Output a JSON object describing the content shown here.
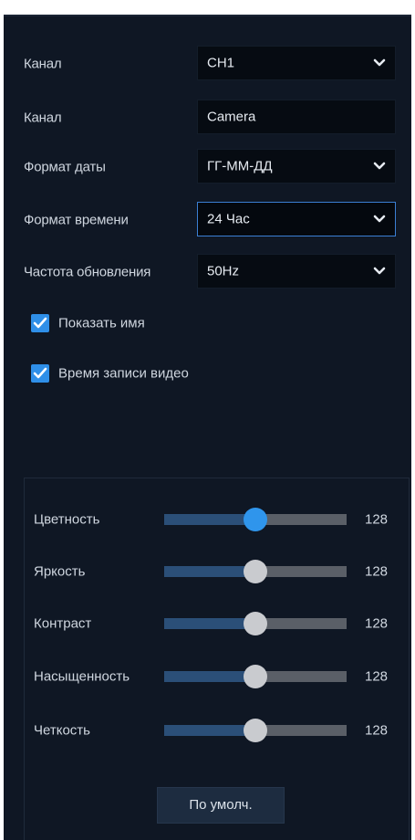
{
  "settings": {
    "channel_select": {
      "label": "Канал",
      "value": "CH1",
      "icon": "chevron-down-icon"
    },
    "channel_name": {
      "label": "Канал",
      "value": "Camera"
    },
    "date_format": {
      "label": "Формат даты",
      "value": "ГГ-ММ-ДД",
      "icon": "chevron-down-icon"
    },
    "time_format": {
      "label": "Формат времени",
      "value": "24 Час",
      "icon": "chevron-down-icon"
    },
    "refresh_rate": {
      "label": "Частота обновления",
      "value": "50Hz",
      "icon": "chevron-down-icon"
    },
    "show_name": {
      "label": "Показать имя",
      "checked": true
    },
    "record_time": {
      "label": "Время записи видео",
      "checked": true
    }
  },
  "image": {
    "sliders": [
      {
        "label": "Цветность",
        "value": "128",
        "level": 0.5,
        "active": true
      },
      {
        "label": "Яркость",
        "value": "128",
        "level": 0.5,
        "active": false
      },
      {
        "label": "Контраст",
        "value": "128",
        "level": 0.5,
        "active": false
      },
      {
        "label": "Насыщенность",
        "value": "128",
        "level": 0.5,
        "active": false
      },
      {
        "label": "Четкость",
        "value": "128",
        "level": 0.5,
        "active": false
      }
    ],
    "default_button": "По умолч."
  },
  "colors": {
    "background": "#0f1724",
    "field": "#060b12",
    "accent": "#2f95ec",
    "checkbox": "#2f8fe8",
    "track": "#5a5f67",
    "track_fill": "#2b4f78"
  }
}
